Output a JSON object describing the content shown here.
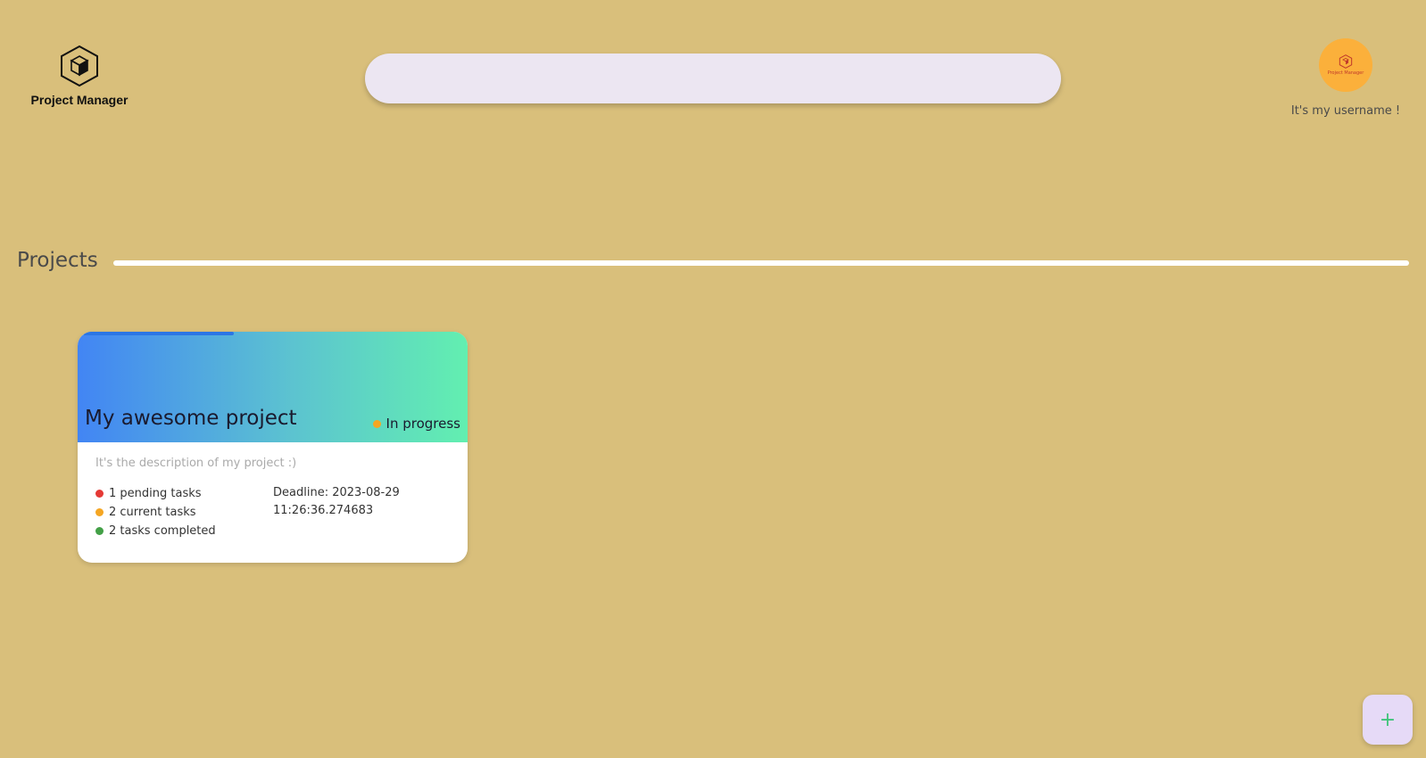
{
  "app": {
    "name": "Project Manager",
    "logo_icon": "cube-hexagon-icon"
  },
  "search": {
    "placeholder": "",
    "value": ""
  },
  "user": {
    "name": "It's my username !",
    "avatar_text": "Project Manager",
    "avatar_color": "#fbb03b"
  },
  "section": {
    "title": "Projects"
  },
  "projects": [
    {
      "title": "My awesome project",
      "status": "In progress",
      "status_color": "#f5a623",
      "progress": 0.4,
      "description": "It's the description of my project :)",
      "stats": [
        {
          "label": "1 pending tasks",
          "color": "#e53935"
        },
        {
          "label": "2 current tasks",
          "color": "#f5a623"
        },
        {
          "label": "2 tasks completed",
          "color": "#43a047"
        }
      ],
      "deadline": "Deadline: 2023-08-29 11:26:36.274683"
    }
  ],
  "fab": {
    "label": "+",
    "icon": "plus-icon"
  },
  "colors": {
    "background": "#d9bf7b",
    "gradient_start": "#4285f4",
    "gradient_end": "#62efb0"
  }
}
